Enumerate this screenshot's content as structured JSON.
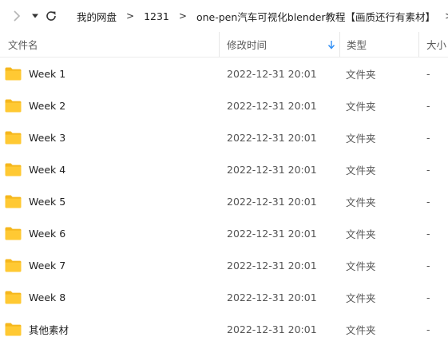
{
  "nav": {
    "breadcrumb": [
      "我的网盘",
      "1231",
      "one-pen汽车可视化blender教程【画质还行有素材】"
    ],
    "separator": ">"
  },
  "columns": {
    "name": "文件名",
    "modified": "修改时间",
    "type": "类型",
    "size": "大小"
  },
  "sort": {
    "column": "modified",
    "direction": "descending"
  },
  "colors": {
    "folder": "#FFC933",
    "folder_tab": "#F5B71D",
    "sort_arrow": "#2f8ef5"
  },
  "rows": [
    {
      "name": "Week 1",
      "modified": "2022-12-31 20:01",
      "type": "文件夹",
      "size": "-"
    },
    {
      "name": "Week 2",
      "modified": "2022-12-31 20:01",
      "type": "文件夹",
      "size": "-"
    },
    {
      "name": "Week 3",
      "modified": "2022-12-31 20:01",
      "type": "文件夹",
      "size": "-"
    },
    {
      "name": "Week 4",
      "modified": "2022-12-31 20:01",
      "type": "文件夹",
      "size": "-"
    },
    {
      "name": "Week 5",
      "modified": "2022-12-31 20:01",
      "type": "文件夹",
      "size": "-"
    },
    {
      "name": "Week 6",
      "modified": "2022-12-31 20:01",
      "type": "文件夹",
      "size": "-"
    },
    {
      "name": "Week 7",
      "modified": "2022-12-31 20:01",
      "type": "文件夹",
      "size": "-"
    },
    {
      "name": "Week 8",
      "modified": "2022-12-31 20:01",
      "type": "文件夹",
      "size": "-"
    },
    {
      "name": "其他素材",
      "modified": "2022-12-31 20:01",
      "type": "文件夹",
      "size": "-"
    }
  ]
}
